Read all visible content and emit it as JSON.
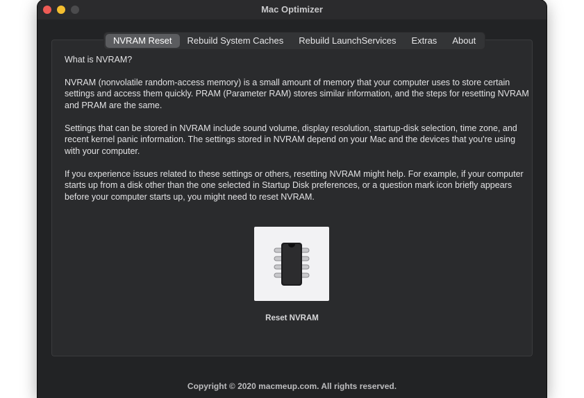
{
  "window": {
    "title": "Mac Optimizer"
  },
  "tabs": [
    {
      "label": "NVRAM Reset",
      "selected": true
    },
    {
      "label": "Rebuild System Caches",
      "selected": false
    },
    {
      "label": "Rebuild LaunchServices",
      "selected": false
    },
    {
      "label": "Extras",
      "selected": false
    },
    {
      "label": "About",
      "selected": false
    }
  ],
  "content": {
    "heading": "What is NVRAM?",
    "paragraphs": [
      "NVRAM (nonvolatile random-access memory) is a small amount of memory that your computer uses to store certain settings and access them quickly. PRAM (Parameter RAM) stores similar information, and the steps for resetting NVRAM and PRAM are the same.",
      "Settings that can be stored in NVRAM include sound volume, display resolution, startup-disk selection, time zone, and recent kernel panic information. The settings stored in NVRAM depend on your Mac and the devices that you're using with your computer.",
      "If you experience issues related to these settings or others, resetting NVRAM might help. For example, if your computer starts up from a disk other than the one selected in Startup Disk preferences, or a question mark icon briefly appears before your computer starts up, you might need to reset NVRAM."
    ]
  },
  "action": {
    "icon": "memory-chip-icon",
    "label": "Reset NVRAM"
  },
  "footer": {
    "copyright": "Copyright © 2020 macmeup.com. All rights reserved."
  },
  "colors": {
    "window_bg": "#222325",
    "panel_bg": "#2a2b2d",
    "selected_tab": "#5b5c5f",
    "close": "#ee5b55",
    "minimize": "#f4be2f"
  }
}
